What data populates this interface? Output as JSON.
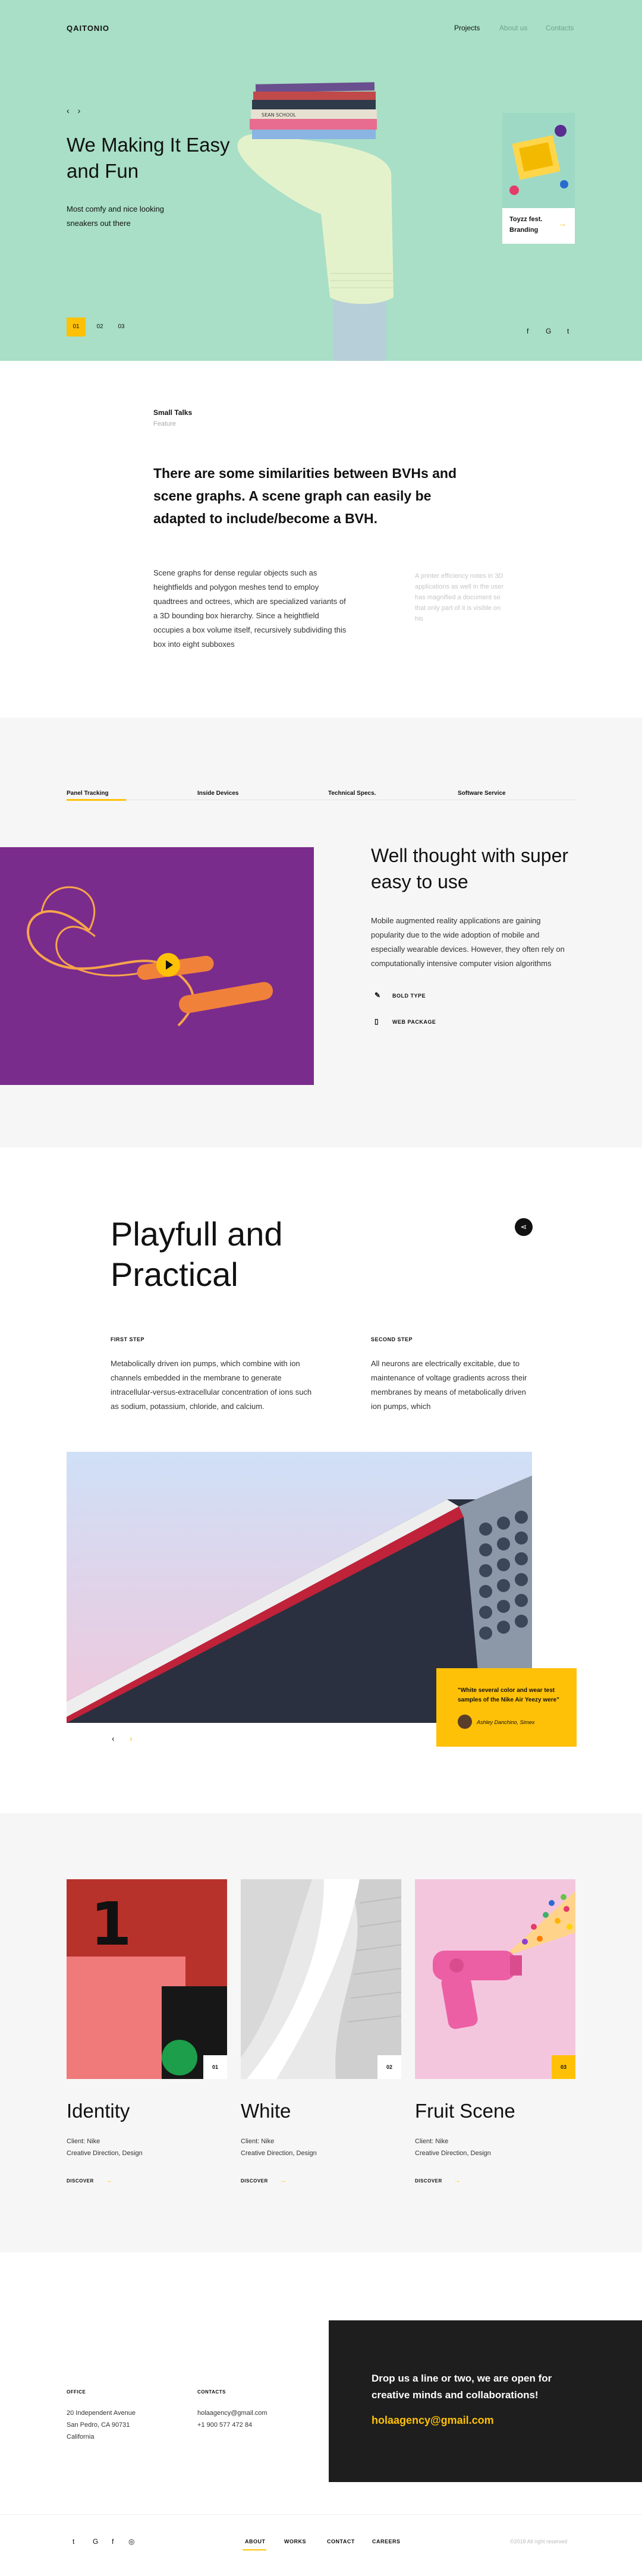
{
  "header": {
    "logo": "QAITONIO",
    "nav": [
      "Projects",
      "About us",
      "Contacts"
    ]
  },
  "hero": {
    "prev_arrow": "‹",
    "next_arrow": "›",
    "title": "We Making It Easy and Fun",
    "subtitle": "Most comfy and nice looking sneakers out there",
    "pager": [
      "01",
      "02",
      "03"
    ],
    "card_caption": "Toyzz fest. Branding",
    "card_arrow": "→",
    "social": [
      "f",
      "G",
      "t"
    ],
    "book_spines": [
      "",
      "",
      "SEAN SCHOOL",
      "",
      "",
      ""
    ],
    "colors": {
      "background": "#a8dfc6",
      "accent": "#ffc107"
    }
  },
  "small_talks": {
    "title": "Small Talks",
    "subtitle": "Feature",
    "lead": "There are some similarities between BVHs and scene graphs. A scene graph can easily be adapted to include/become a BVH.",
    "body": "Scene graphs for dense regular objects such as heightfields and polygon meshes tend to employ quadtrees and octrees, which are specialized variants of a 3D bounding box hierarchy. Since a heightfield occupies a box volume itself, recursively subdividing this box into eight subboxes",
    "faint": "A printer efficiency notes in 3D applications as well in the user has magnified a document so that only part of it is visible on his"
  },
  "tabs_section": {
    "tabs": [
      "Panel Tracking",
      "Inside Devices",
      "Technical Specs.",
      "Software Service"
    ],
    "title": "Well thought with super easy to use",
    "paragraph": "Mobile augmented reality applications are gaining popularity due to the wide adoption of mobile and especially wearable devices. However, they often rely on computationally intensive computer vision algorithms",
    "features": [
      {
        "icon": "pencil-icon",
        "glyph": "✎",
        "label": "BOLD TYPE"
      },
      {
        "icon": "clipboard-icon",
        "glyph": "▯",
        "label": "WEB PACKAGE"
      }
    ]
  },
  "playfull": {
    "title": "Playfull and Practical",
    "share_glyph": "⋖",
    "steps": [
      {
        "title": "FIRST STEP",
        "text": "Metabolically driven ion pumps, which combine with ion channels embedded in the membrane to generate intracellular-versus-extracellular concentration of ions such as sodium, potassium, chloride, and calcium."
      },
      {
        "title": "SECOND STEP",
        "text": "All neurons are electrically excitable, due to maintenance of voltage gradients across their membranes by means of metabolically driven ion pumps, which"
      }
    ],
    "quote": "\"White several color and wear test samples of the Nike Air Yeezy were\"",
    "quote_author": "Ashley Danchino, Simex",
    "slider_prev": "‹",
    "slider_next": "›"
  },
  "works": [
    {
      "num": "01",
      "title": "Identity",
      "client": "Client: Nike",
      "service": "Creative Direction, Design",
      "discover": "DISCOVER",
      "digit": "1"
    },
    {
      "num": "02",
      "title": "White",
      "client": "Client: Nike",
      "service": "Creative Direction, Design",
      "discover": "DISCOVER"
    },
    {
      "num": "03",
      "title": "Fruit Scene",
      "client": "Client: Nike",
      "service": "Creative Direction, Design",
      "discover": "DISCOVER"
    }
  ],
  "works_arrow": "→",
  "contact": {
    "office_label": "OFFICE",
    "office_lines": [
      "20 Independent Avenue",
      "San Pedro, CA 90731",
      "California"
    ],
    "contacts_label": "CONTACTS",
    "contact_lines": [
      "holaagency@gmail.com",
      "+1 900 577 472 84"
    ],
    "cta": "Drop us a line or two, we are open for creative minds and collaborations!",
    "email": "holaagency@gmail.com"
  },
  "footer": {
    "social": [
      "t",
      "G",
      "f",
      "◎"
    ],
    "nav": [
      "ABOUT",
      "WORKS",
      "CONTACT",
      "CAREERS"
    ],
    "copyright": "©2018 All right reserved"
  }
}
